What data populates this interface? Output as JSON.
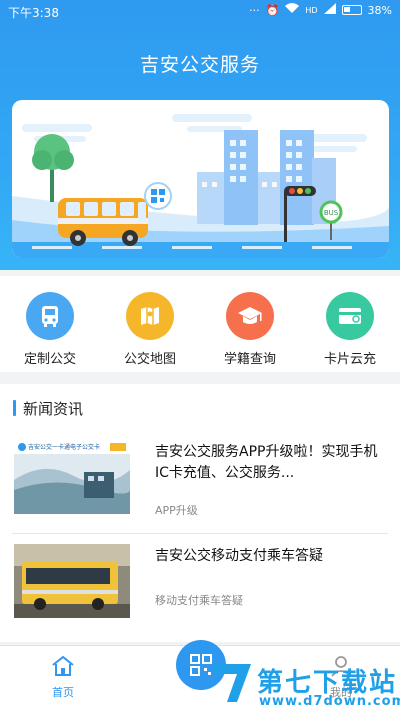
{
  "status_bar": {
    "time": "下午3:38",
    "network": "HD",
    "battery": "38%"
  },
  "header": {
    "title": "吉安公交服务"
  },
  "banner": {
    "bus_stop_sign": "BUS"
  },
  "features": [
    {
      "label": "定制公交",
      "icon": "bus-icon",
      "color": "#4aa8f2"
    },
    {
      "label": "公交地图",
      "icon": "map-icon",
      "color": "#f5b729"
    },
    {
      "label": "学籍查询",
      "icon": "graduation-cap-icon",
      "color": "#f7704d"
    },
    {
      "label": "卡片云充",
      "icon": "card-icon",
      "color": "#38c9a0"
    }
  ],
  "news": {
    "section_title": "新闻资讯",
    "items": [
      {
        "title": "吉安公交服务APP升级啦！实现手机IC卡充值、公交服务...",
        "tag": "APP升级",
        "thumb_caption": "吉安公交一卡通电子公交卡"
      },
      {
        "title": "吉安公交移动支付乘车答疑",
        "tag": "移动支付乘车答疑"
      }
    ]
  },
  "bottom_nav": {
    "home_label": "首页",
    "mine_label": "我的"
  },
  "watermark": {
    "title": "第七下载站",
    "url": "www.d7down.com"
  }
}
